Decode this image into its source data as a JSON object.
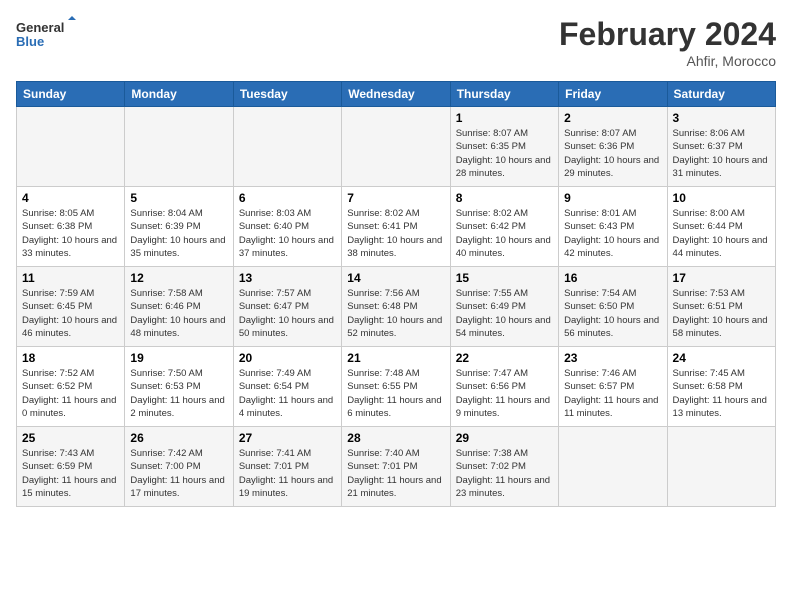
{
  "header": {
    "logo_line1": "General",
    "logo_line2": "Blue",
    "month_year": "February 2024",
    "location": "Ahfir, Morocco"
  },
  "weekdays": [
    "Sunday",
    "Monday",
    "Tuesday",
    "Wednesday",
    "Thursday",
    "Friday",
    "Saturday"
  ],
  "weeks": [
    [
      null,
      null,
      null,
      null,
      {
        "day": 1,
        "sunrise": "8:07 AM",
        "sunset": "6:35 PM",
        "daylight": "10 hours and 28 minutes."
      },
      {
        "day": 2,
        "sunrise": "8:07 AM",
        "sunset": "6:36 PM",
        "daylight": "10 hours and 29 minutes."
      },
      {
        "day": 3,
        "sunrise": "8:06 AM",
        "sunset": "6:37 PM",
        "daylight": "10 hours and 31 minutes."
      }
    ],
    [
      {
        "day": 4,
        "sunrise": "8:05 AM",
        "sunset": "6:38 PM",
        "daylight": "10 hours and 33 minutes."
      },
      {
        "day": 5,
        "sunrise": "8:04 AM",
        "sunset": "6:39 PM",
        "daylight": "10 hours and 35 minutes."
      },
      {
        "day": 6,
        "sunrise": "8:03 AM",
        "sunset": "6:40 PM",
        "daylight": "10 hours and 37 minutes."
      },
      {
        "day": 7,
        "sunrise": "8:02 AM",
        "sunset": "6:41 PM",
        "daylight": "10 hours and 38 minutes."
      },
      {
        "day": 8,
        "sunrise": "8:02 AM",
        "sunset": "6:42 PM",
        "daylight": "10 hours and 40 minutes."
      },
      {
        "day": 9,
        "sunrise": "8:01 AM",
        "sunset": "6:43 PM",
        "daylight": "10 hours and 42 minutes."
      },
      {
        "day": 10,
        "sunrise": "8:00 AM",
        "sunset": "6:44 PM",
        "daylight": "10 hours and 44 minutes."
      }
    ],
    [
      {
        "day": 11,
        "sunrise": "7:59 AM",
        "sunset": "6:45 PM",
        "daylight": "10 hours and 46 minutes."
      },
      {
        "day": 12,
        "sunrise": "7:58 AM",
        "sunset": "6:46 PM",
        "daylight": "10 hours and 48 minutes."
      },
      {
        "day": 13,
        "sunrise": "7:57 AM",
        "sunset": "6:47 PM",
        "daylight": "10 hours and 50 minutes."
      },
      {
        "day": 14,
        "sunrise": "7:56 AM",
        "sunset": "6:48 PM",
        "daylight": "10 hours and 52 minutes."
      },
      {
        "day": 15,
        "sunrise": "7:55 AM",
        "sunset": "6:49 PM",
        "daylight": "10 hours and 54 minutes."
      },
      {
        "day": 16,
        "sunrise": "7:54 AM",
        "sunset": "6:50 PM",
        "daylight": "10 hours and 56 minutes."
      },
      {
        "day": 17,
        "sunrise": "7:53 AM",
        "sunset": "6:51 PM",
        "daylight": "10 hours and 58 minutes."
      }
    ],
    [
      {
        "day": 18,
        "sunrise": "7:52 AM",
        "sunset": "6:52 PM",
        "daylight": "11 hours and 0 minutes."
      },
      {
        "day": 19,
        "sunrise": "7:50 AM",
        "sunset": "6:53 PM",
        "daylight": "11 hours and 2 minutes."
      },
      {
        "day": 20,
        "sunrise": "7:49 AM",
        "sunset": "6:54 PM",
        "daylight": "11 hours and 4 minutes."
      },
      {
        "day": 21,
        "sunrise": "7:48 AM",
        "sunset": "6:55 PM",
        "daylight": "11 hours and 6 minutes."
      },
      {
        "day": 22,
        "sunrise": "7:47 AM",
        "sunset": "6:56 PM",
        "daylight": "11 hours and 9 minutes."
      },
      {
        "day": 23,
        "sunrise": "7:46 AM",
        "sunset": "6:57 PM",
        "daylight": "11 hours and 11 minutes."
      },
      {
        "day": 24,
        "sunrise": "7:45 AM",
        "sunset": "6:58 PM",
        "daylight": "11 hours and 13 minutes."
      }
    ],
    [
      {
        "day": 25,
        "sunrise": "7:43 AM",
        "sunset": "6:59 PM",
        "daylight": "11 hours and 15 minutes."
      },
      {
        "day": 26,
        "sunrise": "7:42 AM",
        "sunset": "7:00 PM",
        "daylight": "11 hours and 17 minutes."
      },
      {
        "day": 27,
        "sunrise": "7:41 AM",
        "sunset": "7:01 PM",
        "daylight": "11 hours and 19 minutes."
      },
      {
        "day": 28,
        "sunrise": "7:40 AM",
        "sunset": "7:01 PM",
        "daylight": "11 hours and 21 minutes."
      },
      {
        "day": 29,
        "sunrise": "7:38 AM",
        "sunset": "7:02 PM",
        "daylight": "11 hours and 23 minutes."
      },
      null,
      null
    ]
  ]
}
